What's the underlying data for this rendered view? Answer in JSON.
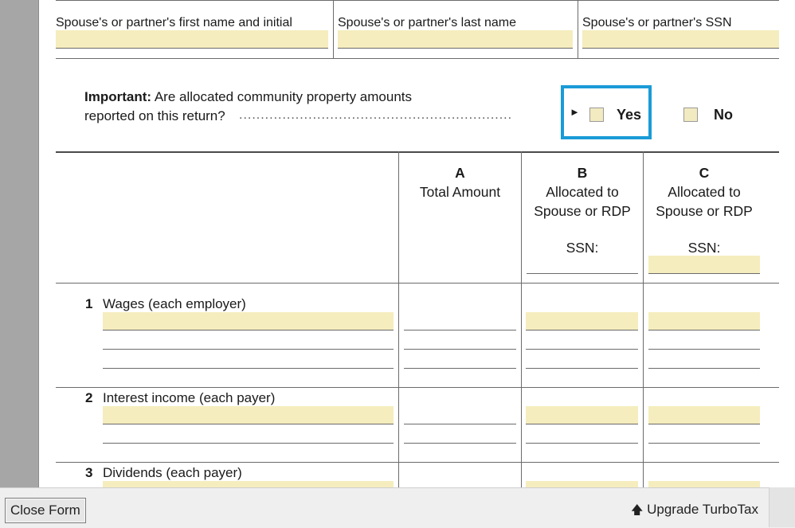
{
  "spouse_fields": {
    "first_name_label": "Spouse's or partner's first name and initial",
    "last_name_label": "Spouse's or partner's last name",
    "ssn_label": "Spouse's or partner's SSN"
  },
  "question": {
    "bold": "Important:",
    "text_line1": "Are allocated community property amounts",
    "text_line2": "reported on this return?",
    "dots": "...............................................................",
    "arrow": "►",
    "yes_label": "Yes",
    "no_label": "No"
  },
  "columns": {
    "a_letter": "A",
    "a_line1": "Total Amount",
    "b_letter": "B",
    "b_line1": "Allocated to",
    "b_line2": "Spouse or RDP",
    "b_ssn": "SSN:",
    "c_letter": "C",
    "c_line1": "Allocated to",
    "c_line2": "Spouse or RDP",
    "c_ssn": "SSN:"
  },
  "rows": [
    {
      "num": "1",
      "label": "Wages (each employer)"
    },
    {
      "num": "2",
      "label": "Interest income (each payer)"
    },
    {
      "num": "3",
      "label": "Dividends (each payer)"
    }
  ],
  "bottom_bar": {
    "close_label": "Close Form",
    "upgrade_icon": "up-arrow-icon",
    "upgrade_arrow": "🡅",
    "upgrade_label": "Upgrade TurboTax"
  },
  "colors": {
    "field_fill": "#f5edbe",
    "highlight_border": "#1a9bd7"
  }
}
